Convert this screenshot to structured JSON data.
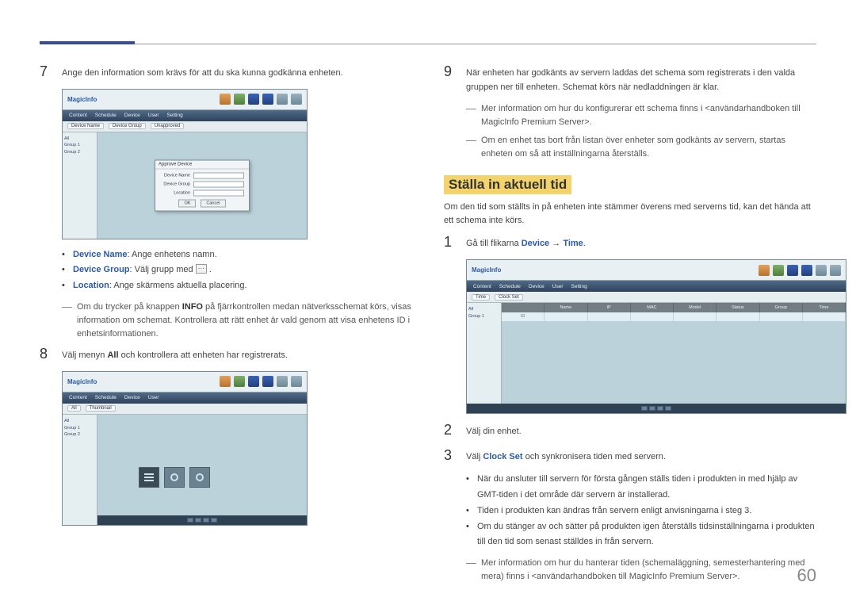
{
  "page_number": "60",
  "left": {
    "step7": "Ange den information som krävs för att du ska kunna godkänna enheten.",
    "bullets": {
      "dn_label": "Device Name",
      "dn_text": ": Ange enhetens namn.",
      "dg_label": "Device Group",
      "dg_text": ": Välj grupp med ",
      "loc_label": "Location",
      "loc_text": ": Ange skärmens aktuella placering."
    },
    "note7a": "Om du trycker på knappen ",
    "note7a_bold": "INFO",
    "note7a_cont": " på fjärrkontrollen medan nätverksschemat körs, visas information om schemat. Kontrollera att rätt enhet är vald genom att visa enhetens ID i enhetsinformationen.",
    "step8_a": "Välj menyn ",
    "step8_bold": "All",
    "step8_b": " och kontrollera att enheten har registrerats."
  },
  "right": {
    "step9": "När enheten har godkänts av servern laddas det schema som registrerats i den valda gruppen ner till enheten. Schemat körs när nedladdningen är klar.",
    "note9a": "Mer information om hur du konfigurerar ett schema finns i <användarhandboken till MagicInfo Premium Server>.",
    "note9b": "Om en enhet tas bort från listan över enheter som godkänts av servern, startas enheten om så att inställningarna återställs.",
    "heading": "Ställa in aktuell tid",
    "intro": "Om den tid som ställts in på enheten inte stämmer överens med serverns tid, kan det hända att ett schema inte körs.",
    "step1_a": "Gå till flikarna ",
    "step1_kw1": "Device",
    "step1_arrow": " → ",
    "step1_kw2": "Time",
    "step1_end": ".",
    "step2": "Välj din enhet.",
    "step3_a": "Välj ",
    "step3_kw": "Clock Set",
    "step3_b": " och synkronisera tiden med servern.",
    "final_bullets": [
      "När du ansluter till servern för första gången ställs tiden i produkten in med hjälp av GMT-tiden i det område där servern är installerad.",
      "Tiden i produkten kan ändras från servern enligt anvisningarna i steg 3.",
      "Om du stänger av och sätter på produkten igen återställs tidsinställningarna i produkten till den tid som senast ställdes in från servern."
    ],
    "final_note": "Mer information om hur du hanterar tiden (schemaläggning, semesterhantering med mera) finns i <användarhandboken till MagicInfo Premium Server>."
  },
  "mock": {
    "logo": "MagicInfo",
    "menu": [
      "Content",
      "Schedule",
      "Device",
      "User",
      "Setting"
    ],
    "dialog_title": "Approve Device",
    "dialog_fields": [
      "Device Name",
      "Device Group",
      "Location"
    ],
    "dialog_btns": [
      "OK",
      "Cancel"
    ],
    "grid_cols": [
      "",
      "Name",
      "IP",
      "MAC",
      "Model",
      "Status",
      "Group",
      "Time"
    ]
  }
}
